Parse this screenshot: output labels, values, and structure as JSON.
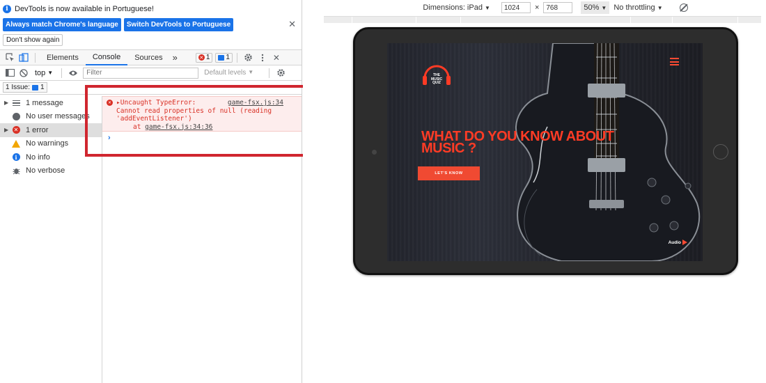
{
  "banner": {
    "message": "DevTools is now available in Portuguese!",
    "btn_match": "Always match Chrome's language",
    "btn_switch": "Switch DevTools to Portuguese",
    "btn_dont_show": "Don't show again",
    "close_glyph": "✕"
  },
  "tabs": {
    "elements": "Elements",
    "console": "Console",
    "sources": "Sources",
    "more": "»",
    "error_count": "1",
    "message_count": "1"
  },
  "toolbar": {
    "context": "top",
    "filter_placeholder": "Filter",
    "levels": "Default levels"
  },
  "issues": {
    "label": "1 Issue:",
    "count": "1"
  },
  "sidebar": {
    "items": [
      {
        "label": "1 message",
        "icon": "list-icon"
      },
      {
        "label": "No user messages",
        "icon": "user-icon"
      },
      {
        "label": "1 error",
        "icon": "error-icon"
      },
      {
        "label": "No warnings",
        "icon": "warning-icon"
      },
      {
        "label": "No info",
        "icon": "info-icon"
      },
      {
        "label": "No verbose",
        "icon": "bug-icon"
      }
    ]
  },
  "console": {
    "error_line1": "▸Uncaught TypeError:",
    "error_file": "game-fsx.js:34",
    "error_line2": "Cannot read properties of null (reading",
    "error_line3": "'addEventListener')",
    "error_at": "at ",
    "error_loc": "game-fsx.js:34:36",
    "prompt": "›"
  },
  "device": {
    "dimensions_label": "Dimensions: iPad",
    "width": "1024",
    "height": "768",
    "times": "×",
    "zoom": "50%",
    "throttling": "No throttling"
  },
  "site": {
    "logo_text": "THE MUSIC QUIZ",
    "hero_title": "WHAT DO YOU KNOW ABOUT MUSIC ?",
    "cta": "LET'S KNOW",
    "audio": "Audio"
  },
  "colors": {
    "accent": "#ff3b25",
    "error": "#d93025",
    "devtools_blue": "#1a73e8",
    "highlight": "#d0262f"
  }
}
